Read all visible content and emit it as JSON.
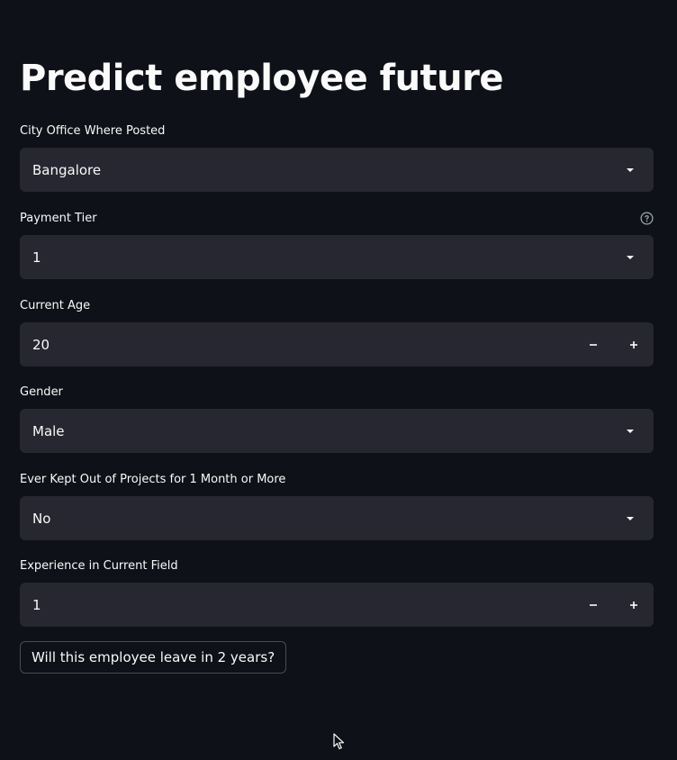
{
  "title": "Predict employee future",
  "fields": {
    "city": {
      "label": "City Office Where Posted",
      "value": "Bangalore"
    },
    "payment_tier": {
      "label": "Payment Tier",
      "value": "1"
    },
    "age": {
      "label": "Current Age",
      "value": "20"
    },
    "gender": {
      "label": "Gender",
      "value": "Male"
    },
    "benched": {
      "label": "Ever Kept Out of Projects for 1 Month or More",
      "value": "No"
    },
    "experience": {
      "label": "Experience in Current Field",
      "value": "1"
    }
  },
  "icons": {
    "help": "question-circle-icon",
    "caret": "caret-down-icon",
    "minus": "minus-icon",
    "plus": "plus-icon",
    "cursor": "mouse-pointer-icon"
  },
  "submit_label": "Will this employee leave in 2 years?",
  "colors": {
    "background": "#0e1117",
    "input_bg": "#262730",
    "text": "#fafafa"
  }
}
